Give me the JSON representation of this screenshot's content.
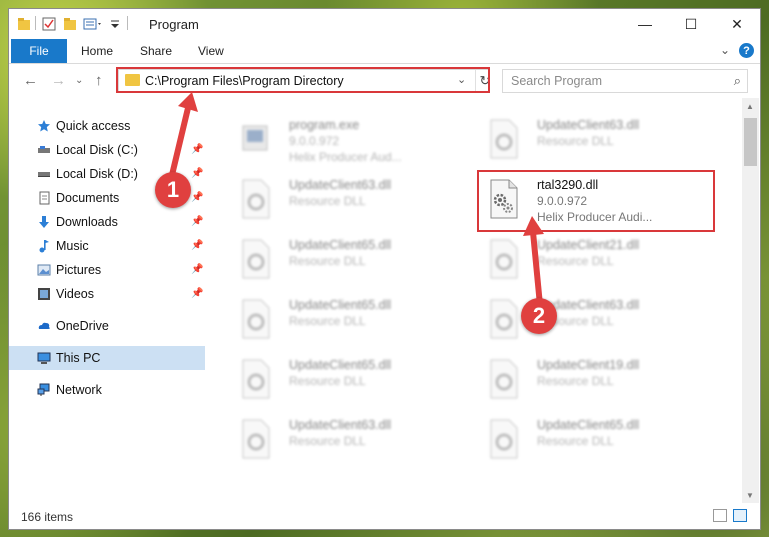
{
  "window": {
    "title": "Program",
    "controls": {
      "minimize": "—",
      "maximize": "☐",
      "close": "✕"
    }
  },
  "ribbon": {
    "file": "File",
    "tabs": [
      "Home",
      "Share",
      "View"
    ],
    "help": "?"
  },
  "nav": {
    "address": "C:\\Program Files\\Program Directory",
    "search_placeholder": "Search Program"
  },
  "sidebar": {
    "items": [
      {
        "label": "Quick access",
        "icon": "star-icon",
        "pinned": false
      },
      {
        "label": "Local Disk (C:)",
        "icon": "drive-icon",
        "pinned": true
      },
      {
        "label": "Local Disk (D:)",
        "icon": "drive-icon",
        "pinned": true
      },
      {
        "label": "Documents",
        "icon": "documents-icon",
        "pinned": true
      },
      {
        "label": "Downloads",
        "icon": "download-icon",
        "pinned": true
      },
      {
        "label": "Music",
        "icon": "music-icon",
        "pinned": true
      },
      {
        "label": "Pictures",
        "icon": "pictures-icon",
        "pinned": true
      },
      {
        "label": "Videos",
        "icon": "videos-icon",
        "pinned": true
      },
      {
        "label": "OneDrive",
        "icon": "cloud-icon",
        "pinned": false
      },
      {
        "label": "This PC",
        "icon": "computer-icon",
        "pinned": false,
        "selected": true
      },
      {
        "label": "Network",
        "icon": "network-icon",
        "pinned": false
      }
    ]
  },
  "files": [
    {
      "name": "program.exe",
      "line2": "9.0.0.972",
      "line3": "Helix Producer Aud...",
      "kind": "exe"
    },
    {
      "name": "UpdateClient63.dll",
      "line2": "Resource DLL",
      "line3": "",
      "kind": "dll"
    },
    {
      "name": "UpdateClient63.dll",
      "line2": "Resource DLL",
      "line3": "",
      "kind": "dll"
    },
    {
      "name": "rtal3290.dll",
      "line2": "9.0.0.972",
      "line3": "Helix Producer Audi...",
      "kind": "dll",
      "highlighted": true
    },
    {
      "name": "UpdateClient65.dll",
      "line2": "Resource DLL",
      "line3": "",
      "kind": "dll"
    },
    {
      "name": "UpdateClient21.dll",
      "line2": "Resource DLL",
      "line3": "",
      "kind": "dll"
    },
    {
      "name": "UpdateClient65.dll",
      "line2": "Resource DLL",
      "line3": "",
      "kind": "dll"
    },
    {
      "name": "UpdateClient63.dll",
      "line2": "Resource DLL",
      "line3": "",
      "kind": "dll"
    },
    {
      "name": "UpdateClient65.dll",
      "line2": "Resource DLL",
      "line3": "",
      "kind": "dll"
    },
    {
      "name": "UpdateClient19.dll",
      "line2": "Resource DLL",
      "line3": "",
      "kind": "dll"
    },
    {
      "name": "UpdateClient63.dll",
      "line2": "Resource DLL",
      "line3": "",
      "kind": "dll"
    },
    {
      "name": "UpdateClient65.dll",
      "line2": "Resource DLL",
      "line3": "",
      "kind": "dll"
    }
  ],
  "status": {
    "count": "166 items"
  },
  "annotations": {
    "step1": "1",
    "step2": "2",
    "color": "#e0403f"
  },
  "colors": {
    "accent": "#1979ca",
    "highlight": "#d9383a",
    "selected": "#cce0f3"
  }
}
